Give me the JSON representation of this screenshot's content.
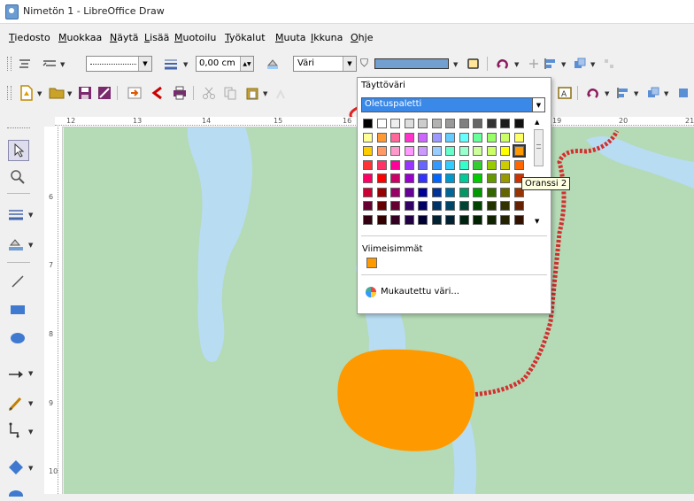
{
  "window": {
    "title": "Nimetön 1 - LibreOffice Draw"
  },
  "menu": [
    "Tiedosto",
    "Muokkaa",
    "Näytä",
    "Lisää",
    "Muotoilu",
    "Työkalut",
    "Muuta",
    "Ikkuna",
    "Ohje"
  ],
  "toolbar1": {
    "line_width": "0,00 cm",
    "area_style": "Väri"
  },
  "ruler_h": [
    "12",
    "13",
    "14",
    "15",
    "16",
    "19",
    "20",
    "21"
  ],
  "ruler_v": [
    "6",
    "7",
    "8",
    "9",
    "10"
  ],
  "popup": {
    "title": "Täyttöväri",
    "palette": "Oletuspaletti",
    "recent_label": "Viimeisimmät",
    "custom_label": "Mukautettu väri...",
    "tooltip": "Oranssi 2",
    "recent_color": "#ff9900",
    "colors": [
      [
        "#000000",
        "#ffffff",
        "#eeeeee",
        "#dddddd",
        "#cccccc",
        "#b2b2b2",
        "#999999",
        "#808080",
        "#666666",
        "#333333",
        "#1c1c1c",
        "#111111"
      ],
      [
        "#ffff99",
        "#ff9933",
        "#ff6699",
        "#ff33cc",
        "#cc66ff",
        "#9999ff",
        "#66ccff",
        "#66ffff",
        "#66ff99",
        "#99ff66",
        "#ccff66",
        "#ffff66"
      ],
      [
        "#ffcc00",
        "#ff9966",
        "#ff99cc",
        "#ff99ff",
        "#cc99ff",
        "#99ccff",
        "#66ffcc",
        "#99ffcc",
        "#ccff99",
        "#ccff66",
        "#ffff00",
        "#ff9900"
      ],
      [
        "#ff3333",
        "#ff3366",
        "#ff0099",
        "#9933ff",
        "#6666ff",
        "#3399ff",
        "#33ccff",
        "#33ffcc",
        "#33cc33",
        "#99cc00",
        "#cccc00",
        "#ff6600"
      ],
      [
        "#ff0066",
        "#ff0000",
        "#cc0066",
        "#9900cc",
        "#3333ff",
        "#0066ff",
        "#0099cc",
        "#00cc99",
        "#00cc00",
        "#669900",
        "#999900",
        "#cc3300"
      ],
      [
        "#cc0033",
        "#990000",
        "#990066",
        "#660099",
        "#000099",
        "#003399",
        "#006699",
        "#009966",
        "#009900",
        "#336600",
        "#666600",
        "#993300"
      ],
      [
        "#660033",
        "#660000",
        "#660033",
        "#330066",
        "#000066",
        "#003366",
        "#004466",
        "#004433",
        "#004400",
        "#223300",
        "#333300",
        "#662200"
      ],
      [
        "#330011",
        "#330000",
        "#330022",
        "#220044",
        "#000033",
        "#002233",
        "#002233",
        "#002211",
        "#002200",
        "#112200",
        "#222200",
        "#331100"
      ]
    ]
  },
  "shape": {
    "color": "#ff9900"
  },
  "colors": {
    "map_bg": "#b4dab6",
    "water": "#b8dcf2",
    "path": "#d42e2e",
    "highlight": "#dd2222"
  }
}
